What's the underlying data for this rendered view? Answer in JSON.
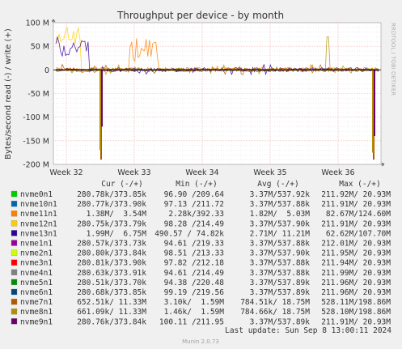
{
  "chart_data": {
    "type": "line",
    "title": "Throughput per device - by month",
    "ylabel": "Bytes/second read (-) / write (+)",
    "watermark": "RRDTOOL / TOBI OETIKER",
    "ylim": [
      -200,
      100
    ],
    "y_unit": "M",
    "yticks": [
      "100 M",
      "50 M",
      "0",
      "-50 M",
      "-100 M",
      "-150 M",
      "-200 M"
    ],
    "yticks_values": [
      100,
      50,
      0,
      -50,
      -100,
      -150,
      -200
    ],
    "xticks": [
      "Week 32",
      "Week 33",
      "Week 34",
      "Week 35",
      "Week 36"
    ],
    "grid": true,
    "header": {
      "cur": "Cur (-/+)",
      "min": "Min (-/+)",
      "avg": "Avg (-/+)",
      "max": "Max (-/+)"
    },
    "series": [
      {
        "name": "nvme0n1",
        "color": "#00cc00",
        "cur": "280.78k/373.85k",
        "min": "96.90 /209.64",
        "avg": "3.37M/537.92k",
        "max": "211.92M/ 20.93M"
      },
      {
        "name": "nvme10n1",
        "color": "#0066b3",
        "cur": "280.77k/373.90k",
        "min": "97.13 /211.72",
        "avg": "3.37M/537.88k",
        "max": "211.91M/ 20.93M"
      },
      {
        "name": "nvme11n1",
        "color": "#ff8000",
        "cur": "1.38M/  3.54M",
        "min": "2.28k/392.33",
        "avg": "1.82M/  5.03M",
        "max": "82.67M/124.60M"
      },
      {
        "name": "nvme12n1",
        "color": "#ffcc00",
        "cur": "280.75k/373.79k",
        "min": "98.28 /214.49",
        "avg": "3.37M/537.90k",
        "max": "211.91M/ 20.93M"
      },
      {
        "name": "nvme13n1",
        "color": "#330099",
        "cur": "1.99M/  6.75M",
        "min": "490.57 / 74.82k",
        "avg": "2.71M/ 11.21M",
        "max": "62.62M/107.70M"
      },
      {
        "name": "nvme1n1",
        "color": "#990099",
        "cur": "280.57k/373.73k",
        "min": "94.61 /219.33",
        "avg": "3.37M/537.88k",
        "max": "212.01M/ 20.93M"
      },
      {
        "name": "nvme2n1",
        "color": "#ccff00",
        "cur": "280.80k/373.84k",
        "min": "98.51 /213.33",
        "avg": "3.37M/537.90k",
        "max": "211.95M/ 20.93M"
      },
      {
        "name": "nvme3n1",
        "color": "#ff0000",
        "cur": "280.81k/373.90k",
        "min": "97.82 /212.18",
        "avg": "3.37M/537.88k",
        "max": "211.94M/ 20.93M"
      },
      {
        "name": "nvme4n1",
        "color": "#808080",
        "cur": "280.63k/373.91k",
        "min": "94.61 /214.49",
        "avg": "3.37M/537.88k",
        "max": "211.99M/ 20.93M"
      },
      {
        "name": "nvme5n1",
        "color": "#008f00",
        "cur": "280.51k/373.70k",
        "min": "94.38 /220.48",
        "avg": "3.37M/537.89k",
        "max": "211.96M/ 20.93M"
      },
      {
        "name": "nvme6n1",
        "color": "#00487d",
        "cur": "280.68k/373.85k",
        "min": "99.19 /219.56",
        "avg": "3.37M/537.89k",
        "max": "211.96M/ 20.93M"
      },
      {
        "name": "nvme7n1",
        "color": "#b35a00",
        "cur": "652.51k/ 11.33M",
        "min": "3.10k/  1.59M",
        "avg": "784.51k/ 18.75M",
        "max": "528.11M/198.86M"
      },
      {
        "name": "nvme8n1",
        "color": "#b38f00",
        "cur": "661.09k/ 11.33M",
        "min": "1.46k/  1.59M",
        "avg": "784.66k/ 18.75M",
        "max": "528.10M/198.86M"
      },
      {
        "name": "nvme9n1",
        "color": "#6b006b",
        "cur": "280.76k/373.84k",
        "min": "100.11 /211.95",
        "avg": "3.37M/537.89k",
        "max": "211.91M/ 20.93M"
      }
    ],
    "last_update": "Last update: Sun Sep  8 13:00:11 2024",
    "footer": "Munin 2.0.73"
  }
}
